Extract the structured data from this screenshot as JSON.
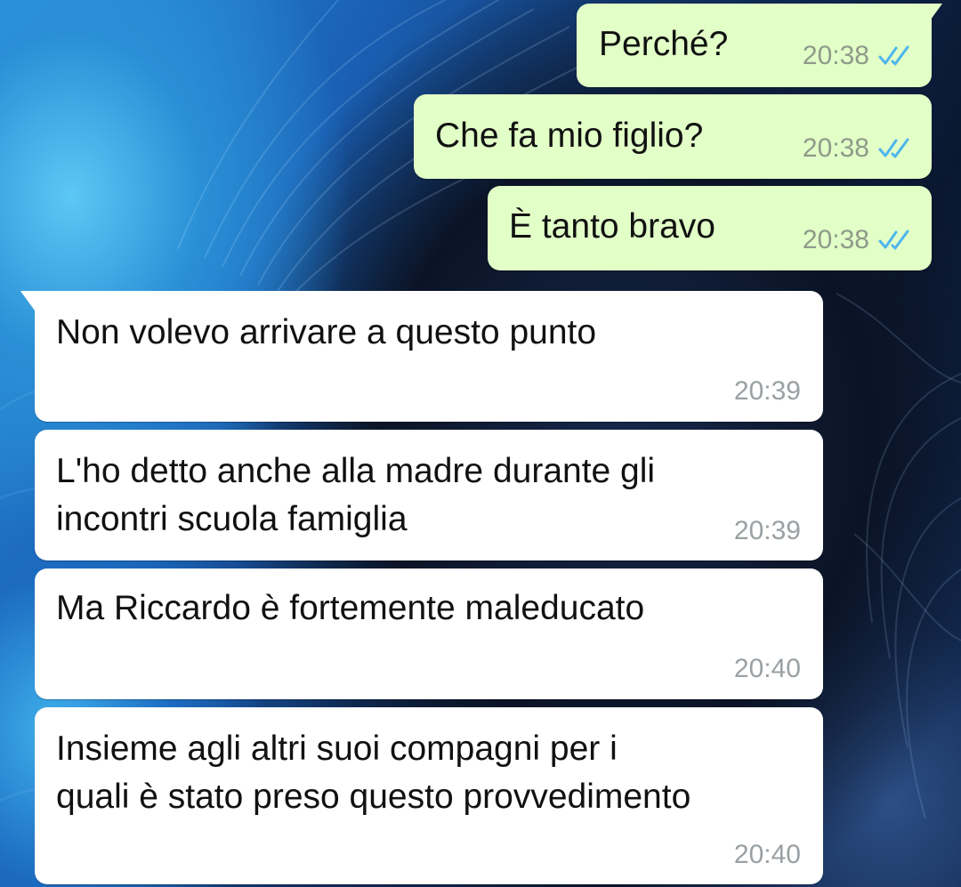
{
  "colors": {
    "outgoing_bubble": "#e2ffc7",
    "incoming_bubble": "#ffffff",
    "read_ticks": "#4fb6ec",
    "timestamp": "#8f9a8a"
  },
  "messages": [
    {
      "direction": "outgoing",
      "text": "Perché?",
      "time": "20:38",
      "status_icon": "double-check-read-icon"
    },
    {
      "direction": "outgoing",
      "text": "Che fa mio figlio?",
      "time": "20:38",
      "status_icon": "double-check-read-icon"
    },
    {
      "direction": "outgoing",
      "text": "È tanto bravo",
      "time": "20:38",
      "status_icon": "double-check-read-icon"
    },
    {
      "direction": "incoming",
      "text": "Non volevo arrivare a questo punto",
      "time": "20:39"
    },
    {
      "direction": "incoming",
      "text": "L'ho detto anche alla madre durante gli\nincontri scuola famiglia",
      "time": "20:39"
    },
    {
      "direction": "incoming",
      "text": "Ma Riccardo è fortemente maleducato",
      "time": "20:40"
    },
    {
      "direction": "incoming",
      "text": "Insieme agli altri suoi compagni per i\nquali è stato preso questo provvedimento",
      "time": "20:40"
    }
  ]
}
